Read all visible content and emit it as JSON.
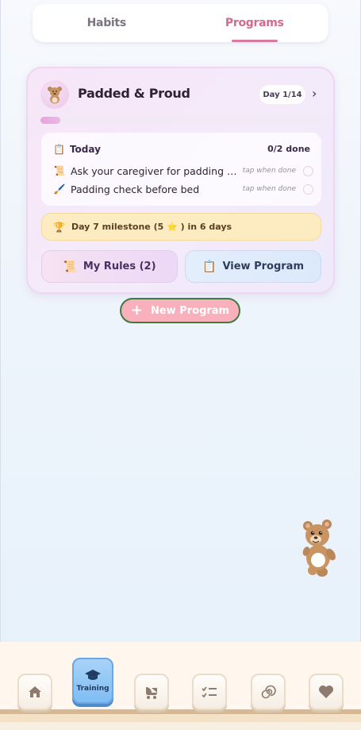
{
  "tabs": [
    {
      "label": "Habits",
      "active": false
    },
    {
      "label": "Programs",
      "active": true
    }
  ],
  "program": {
    "icon": "teddy-bear-icon",
    "title": "Padded & Proud",
    "day_label": "Day 1/14",
    "progress": 0.07,
    "today": {
      "heading": "Today",
      "done_count": "0/2 done",
      "tasks": [
        {
          "icon": "scroll-icon",
          "text": "Ask your caregiver for padding chec...",
          "hint": "tap when done"
        },
        {
          "icon": "brush-icon",
          "text": "Padding check before bed",
          "hint": "tap when done"
        }
      ]
    },
    "milestone": {
      "icon": "trophy-icon",
      "text": "Day 7 milestone (5 ⭐ ) in 6 days"
    },
    "rules_button": "My Rules (2)",
    "view_button": "View Program"
  },
  "new_program_button": "New Program",
  "mascot": "teddy-bear-mascot",
  "nav": {
    "items": [
      {
        "icon": "home-icon",
        "label": ""
      },
      {
        "icon": "graduation-cap-icon",
        "label": "Training",
        "active": true
      },
      {
        "icon": "baby-carriage-icon",
        "label": ""
      },
      {
        "icon": "checklist-icon",
        "label": ""
      },
      {
        "icon": "spiral-icon",
        "label": ""
      },
      {
        "icon": "heart-icon",
        "label": ""
      }
    ]
  },
  "colors": {
    "accent_pink": "#d06a8e",
    "card_bg": "#f4ebfa",
    "milestone_bg": "#fdebc2",
    "nav_active": "#7fbdf3"
  }
}
